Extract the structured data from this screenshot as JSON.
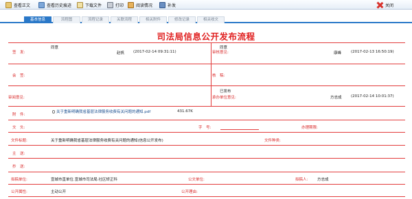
{
  "toolbar": {
    "view_text": "查看正文",
    "view_history": "查看历史痕迹",
    "download": "下载文件",
    "print": "打印",
    "read_status": "阅读情况",
    "supplement": "补发",
    "close": "关闭"
  },
  "tabs": [
    "基本信息",
    "流程图",
    "流程记录",
    "关联流程",
    "相关附件",
    "修改记录",
    "相关收文"
  ],
  "title": "司法局信息公开发布流程",
  "form": {
    "sign_label": "签　发:",
    "sign_opinion": "同意",
    "sign_person": "赵帆",
    "sign_time": "(2017-02-14 09:31:11)",
    "review_label": "审核意见:",
    "review_opinion": "同意",
    "review_person": "康峰",
    "review_time": "(2017-02-13 16:50:19)",
    "countersign_label": "会　签:",
    "proofread_label": "核　稿:",
    "approval_label": "审阅意见:",
    "dept_label": "承办单位意见:",
    "dept_opinion": "已发布",
    "dept_person": "方志成",
    "dept_time": "(2017-02-14 10:01:37)",
    "attachment_label": "附　件:",
    "attachment_name": "关于重新明确我省基层法律服务收费有关问题的通知.pdf",
    "attachment_size": "431.67K",
    "doc_head_label": "文　头:",
    "doc_no_label": "字　号:",
    "doc_no_value": "",
    "deadline_label": "办理期限:",
    "doc_title_label": "文件标题:",
    "doc_title_value": "关于重新明确我省基层法律服务收费有关问题的通知(信息公开发布)",
    "doc_type_label": "文件种类:",
    "main_send_label": "主　送:",
    "cc_label": "抄　送:",
    "drafting_unit_label": "拟稿单位:",
    "drafting_unit_value": "宣城市直单位.宣城市司法局.社区矫正科",
    "seal_unit_label": "公文单位:",
    "drafter_label": "拟稿人:",
    "drafter_value": "方志成",
    "public_attr_label": "公开属性:",
    "public_attr_value": "主动公开",
    "public_reason_label": "公开理由:"
  }
}
